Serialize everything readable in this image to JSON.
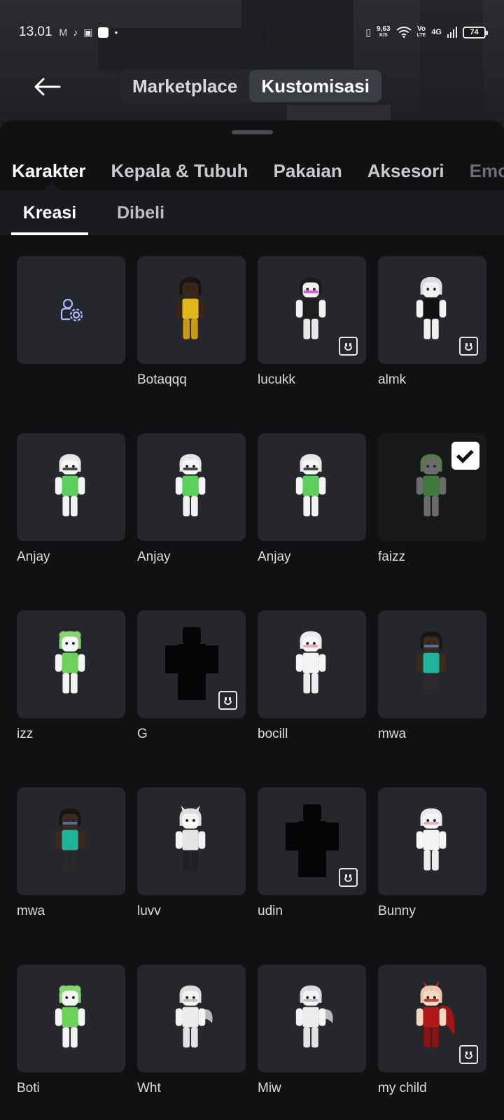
{
  "status_bar": {
    "time": "13.01",
    "net_speed_value": "9,63",
    "net_speed_unit": "K/S",
    "volte_top": "Vo",
    "volte_bottom": "LTE",
    "network": "4G",
    "battery": "74"
  },
  "header": {
    "tabs": [
      {
        "label": "Marketplace",
        "active": false
      },
      {
        "label": "Kustomisasi",
        "active": true
      }
    ]
  },
  "category_tabs": [
    {
      "label": "Karakter",
      "active": true
    },
    {
      "label": "Kepala & Tubuh",
      "active": false
    },
    {
      "label": "Pakaian",
      "active": false
    },
    {
      "label": "Aksesori",
      "active": false
    },
    {
      "label": "Emo",
      "active": false
    }
  ],
  "sub_tabs": [
    {
      "label": "Kreasi",
      "active": true
    },
    {
      "label": "Dibeli",
      "active": false
    }
  ],
  "items": [
    {
      "name": "",
      "kind": "create",
      "badge": null
    },
    {
      "name": "Botaqqq",
      "kind": "dark-yellow",
      "badge": null
    },
    {
      "name": "lucukk",
      "kind": "black-white",
      "badge": "face"
    },
    {
      "name": "almk",
      "kind": "white-black",
      "badge": "face"
    },
    {
      "name": "Anjay",
      "kind": "white-green",
      "badge": null
    },
    {
      "name": "Anjay",
      "kind": "white-green",
      "badge": null
    },
    {
      "name": "Anjay",
      "kind": "white-green",
      "badge": null
    },
    {
      "name": "faizz",
      "kind": "green-dim",
      "badge": "check"
    },
    {
      "name": "izz",
      "kind": "green-frog",
      "badge": null
    },
    {
      "name": "G",
      "kind": "blank",
      "badge": "face"
    },
    {
      "name": "bocill",
      "kind": "white-pink",
      "badge": null
    },
    {
      "name": "mwa",
      "kind": "dark-teal",
      "badge": null
    },
    {
      "name": "mwa",
      "kind": "dark-teal",
      "badge": null
    },
    {
      "name": "luvv",
      "kind": "white-horns",
      "badge": null
    },
    {
      "name": "udin",
      "kind": "blank",
      "badge": "face"
    },
    {
      "name": "Bunny",
      "kind": "white-pink",
      "badge": null
    },
    {
      "name": "Boti",
      "kind": "green-frog",
      "badge": null
    },
    {
      "name": "Wht",
      "kind": "white-wings",
      "badge": null
    },
    {
      "name": "Miw",
      "kind": "white-wings",
      "badge": null
    },
    {
      "name": "my child",
      "kind": "red-demon",
      "badge": "face"
    }
  ],
  "colors": {
    "background": "#101113",
    "tile": "#26272c",
    "subtab_bar": "#1a1b1e",
    "active_segment": "#3b3d44",
    "text_primary": "#ffffff",
    "text_secondary": "#c9cacd"
  }
}
